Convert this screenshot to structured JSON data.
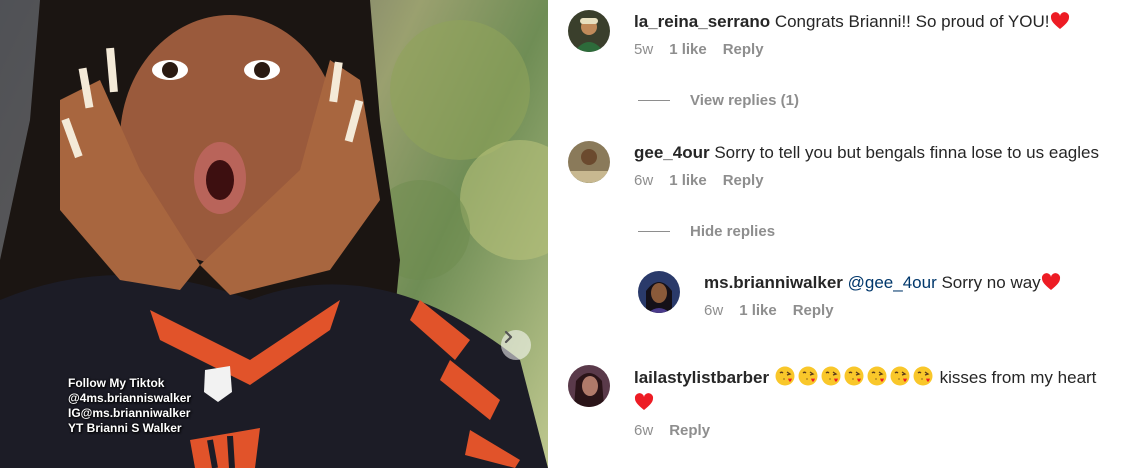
{
  "photo": {
    "overlay_lines": [
      "Follow My Tiktok",
      "@4ms.brianniswalker",
      "IG@ms.brianniwalker",
      "YT Brianni S Walker"
    ],
    "next_icon": "chevron-right-icon"
  },
  "comments": [
    {
      "username": "la_reina_serrano",
      "text": "Congrats Brianni!! So proud of YOU!",
      "has_heart": true,
      "time": "5w",
      "likes": "1 like",
      "reply_label": "Reply",
      "replies_toggle": "View replies (1)"
    },
    {
      "username": "gee_4our",
      "text": "Sorry to tell you but bengals finna lose to us eagles",
      "time": "6w",
      "likes": "1 like",
      "reply_label": "Reply",
      "replies_toggle": "Hide replies",
      "reply": {
        "username": "ms.brianniwalker",
        "mention": "@gee_4our",
        "text": "Sorry no way",
        "has_heart": true,
        "time": "6w",
        "likes": "1 like",
        "reply_label": "Reply"
      }
    },
    {
      "username": "lailastylistbarber",
      "emoji_count": 7,
      "emoji_name": "face-blowing-a-kiss",
      "text": "kisses from my heart",
      "has_heart": true,
      "time": "6w",
      "reply_label": "Reply"
    }
  ],
  "colors": {
    "text": "#262626",
    "meta": "#8e8e8e",
    "mention": "#00376b",
    "heart": "#ed1c24"
  }
}
